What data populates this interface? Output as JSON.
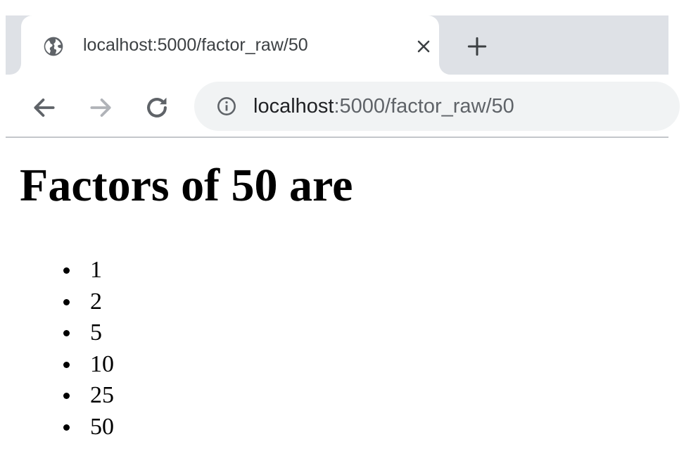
{
  "browser": {
    "tab": {
      "title": "localhost:5000/factor_raw/50",
      "favicon": "globe-icon"
    },
    "address_bar": {
      "host": "localhost",
      "path": ":5000/factor_raw/50",
      "security_icon": "info-icon"
    },
    "colors": {
      "tabstrip": "#dee1e6",
      "omnibox": "#f1f3f4",
      "icon": "#5f6368",
      "icon_disabled": "#b0b3b8"
    }
  },
  "page": {
    "heading": "Factors of 50 are",
    "factors": [
      "1",
      "2",
      "5",
      "10",
      "25",
      "50"
    ]
  }
}
